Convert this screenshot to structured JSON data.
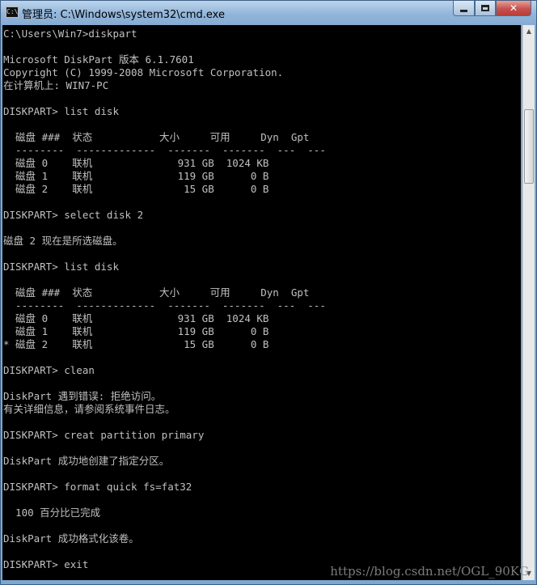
{
  "window": {
    "title": "管理员: C:\\Windows\\system32\\cmd.exe",
    "icon": "C:\\"
  },
  "console": {
    "text": "C:\\Users\\Win7>diskpart\n\nMicrosoft DiskPart 版本 6.1.7601\nCopyright (C) 1999-2008 Microsoft Corporation.\n在计算机上: WIN7-PC\n\nDISKPART> list disk\n\n  磁盘 ###  状态           大小     可用     Dyn  Gpt\n  --------  -------------  -------  -------  ---  ---\n  磁盘 0    联机              931 GB  1024 KB\n  磁盘 1    联机              119 GB      0 B\n  磁盘 2    联机               15 GB      0 B\n\nDISKPART> select disk 2\n\n磁盘 2 现在是所选磁盘。\n\nDISKPART> list disk\n\n  磁盘 ###  状态           大小     可用     Dyn  Gpt\n  --------  -------------  -------  -------  ---  ---\n  磁盘 0    联机              931 GB  1024 KB\n  磁盘 1    联机              119 GB      0 B\n* 磁盘 2    联机               15 GB      0 B\n\nDISKPART> clean\n\nDiskPart 遇到错误: 拒绝访问。\n有关详细信息，请参阅系统事件日志。\n\nDISKPART> creat partition primary\n\nDiskPart 成功地创建了指定分区。\n\nDISKPART> format quick fs=fat32\n\n  100 百分比已完成\n\nDiskPart 成功格式化该卷。\n\nDISKPART> exit"
  },
  "watermark": "https://blog.csdn.net/OGL_90KG"
}
